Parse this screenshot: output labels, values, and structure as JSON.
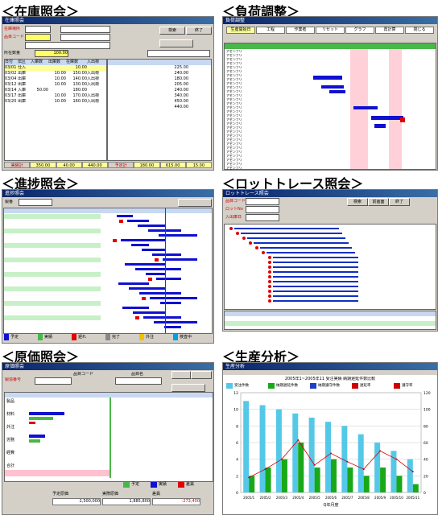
{
  "titles": {
    "inventory": "＜在庫照会＞",
    "load": "＜負荷調整＞",
    "progress": "＜進捗照会＞",
    "lot": "＜ロットトレース照会＞",
    "cost": "＜原価照会＞",
    "production": "＜生産分析＞"
  },
  "inventory": {
    "window_title": "在庫照会",
    "code_label": "在庫場所",
    "item_label": "品目コード",
    "search_btn": "検索",
    "clear_btn": "終了",
    "qty_label": "所在数量",
    "qty_value": "100.00",
    "col_headers": [
      "日付",
      "伝区",
      "入庫数",
      "出庫数",
      "在庫数",
      "入出荷"
    ],
    "rows": [
      [
        "03/01",
        "仕入",
        "",
        "",
        "10.00",
        ""
      ],
      [
        "03/02",
        "出庫",
        "",
        "10.00",
        "150.00",
        "入出荷"
      ],
      [
        "03/04",
        "出庫",
        "",
        "10.00",
        "140.00",
        "入出荷"
      ],
      [
        "03/12",
        "出庫",
        "",
        "10.00",
        "130.00",
        "入出荷"
      ],
      [
        "03/14",
        "入庫",
        "50.00",
        "",
        "180.00",
        ""
      ],
      [
        "03/17",
        "出庫",
        "",
        "10.00",
        "170.00",
        "入出荷"
      ],
      [
        "03/20",
        "出庫",
        "",
        "10.00",
        "160.00",
        "入出荷"
      ]
    ],
    "right_rows": [
      "225.00",
      "240.00",
      "180.00",
      "205.00",
      "240.00",
      "340.00",
      "450.00",
      "440.00"
    ],
    "footer_labels": [
      "実績計",
      "350.00",
      "40.00",
      "440.00",
      "予定計",
      "180.00",
      "615.00",
      "15.00"
    ]
  },
  "load": {
    "window_title": "負荷調整",
    "header_items": [
      "生産開始日",
      "工程",
      "作業者",
      "リセット",
      "グラフ",
      "再計算",
      "閉じる"
    ],
    "row_label": "アセンブリ",
    "row_count": 30
  },
  "progress": {
    "window_title": "進捗照会",
    "header_label": "製番",
    "legend": [
      "予定",
      "実績",
      "遅れ",
      "完了",
      "外注",
      "検査中"
    ],
    "row_count": 24
  },
  "lot": {
    "window_title": "ロットトレース照会",
    "labels": [
      "品目コード",
      "ロットNo",
      "入出庫日"
    ],
    "buttons": [
      "検索",
      "前画面",
      "終了"
    ],
    "tree_count": 16
  },
  "cost": {
    "window_title": "原価照会",
    "labels": [
      "品目コード",
      "品目名",
      "製造番号"
    ],
    "categories": [
      "製品",
      "材料",
      "外注",
      "労務",
      "経費",
      "合計"
    ],
    "totals_labels": [
      "予定原価",
      "実際原価",
      "差異"
    ],
    "totals_values": [
      "2,500,000",
      "1,885,800",
      "-273,400"
    ],
    "legend": [
      "予定",
      "実績",
      "差異"
    ]
  },
  "production": {
    "window_title": "生産分析",
    "chart_title": "2005年1~2005年11  受注実績  納期遅延件数比較",
    "legend": [
      "受注件数",
      "納期遅延件数",
      "納期遵守件数",
      "遅延率",
      "遵守率"
    ],
    "xlabel": "Q年月度",
    "colors": {
      "bar1": "#55c8e8",
      "bar2": "#18a818",
      "line": "#d00000"
    }
  },
  "chart_data": {
    "type": "bar",
    "title": "2005年1~2005年11  受注実績  納期遅延件数比較",
    "categories": [
      "2005/1",
      "2005/2",
      "2005/3",
      "2005/4",
      "2005/5",
      "2005/6",
      "2005/7",
      "2005/8",
      "2005/9",
      "2005/10",
      "2005/11"
    ],
    "series": [
      {
        "name": "受注件数",
        "values": [
          11,
          10.5,
          10,
          9.5,
          9,
          8.5,
          8,
          7,
          6,
          5,
          4
        ]
      },
      {
        "name": "納期遅延件数",
        "values": [
          2,
          3,
          4,
          6,
          3,
          4,
          3,
          2,
          3,
          2,
          1
        ]
      },
      {
        "name": "遅延率",
        "values": [
          18,
          28,
          40,
          63,
          33,
          47,
          37,
          28,
          50,
          40,
          25
        ]
      }
    ],
    "ylim": [
      0,
      12
    ],
    "xlabel": "Q年月度"
  }
}
